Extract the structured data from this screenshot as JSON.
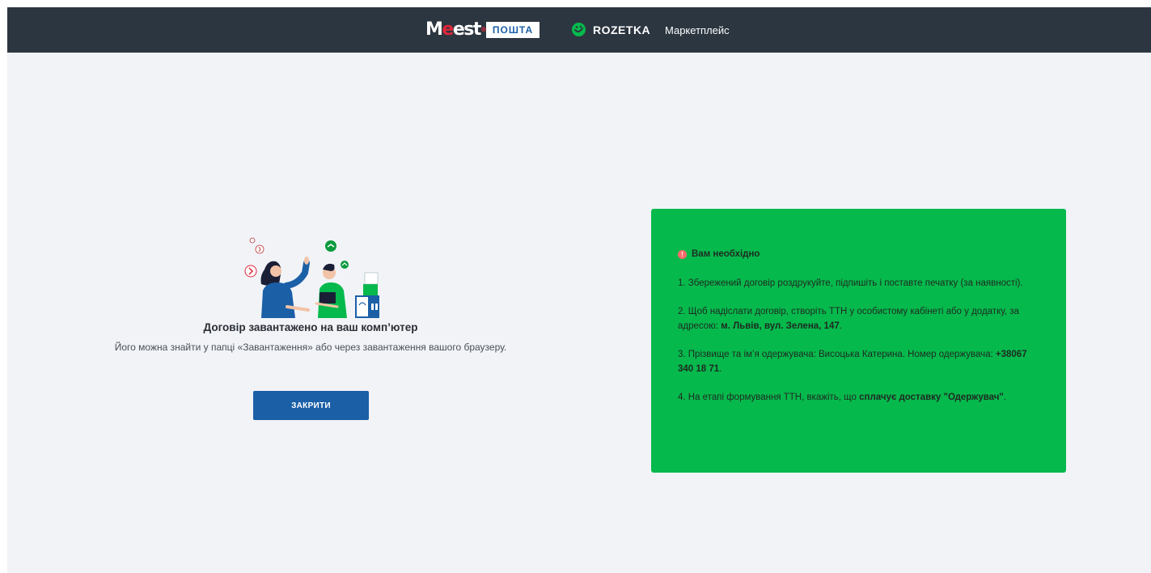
{
  "header": {
    "meest_prefix": "M",
    "meest_red": "e",
    "meest_suffix": "est",
    "meest_mark": "®",
    "poshta_label": "ПОШТА",
    "rozetka_name": "ROZETKA",
    "rozetka_market": "Маркетплейс"
  },
  "main": {
    "title": "Договір завантажено на ваш комп’ютер",
    "subtitle": "Його можна знайти у папці «Завантаження» або через завантаження вашого браузеру.",
    "close_button": "ЗАКРИТИ"
  },
  "info": {
    "warn_glyph": "!",
    "heading": "Вам необхідно",
    "step1": "1. Збережений договір роздрукуйте, підпишіть і поставте печатку (за наявності).",
    "step2_prefix": "2. Щоб надіслати договір, створіть ТТН у особистому кабінеті або у додатку, за адресою: ",
    "step2_bold": "м. Львів, вул. Зелена, 147",
    "step2_suffix": ".",
    "step3_prefix": "3. Прізвище та ім’я одержувача: Висоцька Катерина. Номер одержувача: ",
    "step3_bold": "+38067 340 18 71",
    "step3_suffix": ".",
    "step4_prefix": "4. На етапі формування ТТН, вкажіть, що ",
    "step4_bold": "сплачує доставку \"Одержувач\"",
    "step4_suffix": "."
  },
  "colors": {
    "header_bg": "#2c3640",
    "page_bg": "#f1f3f7",
    "card_green": "#06b94c",
    "button_blue": "#1b5fa7",
    "meest_red": "#e0263a"
  },
  "icons": [
    "rozetka-logo-icon",
    "warning-icon",
    "illustration-people-parcels"
  ]
}
